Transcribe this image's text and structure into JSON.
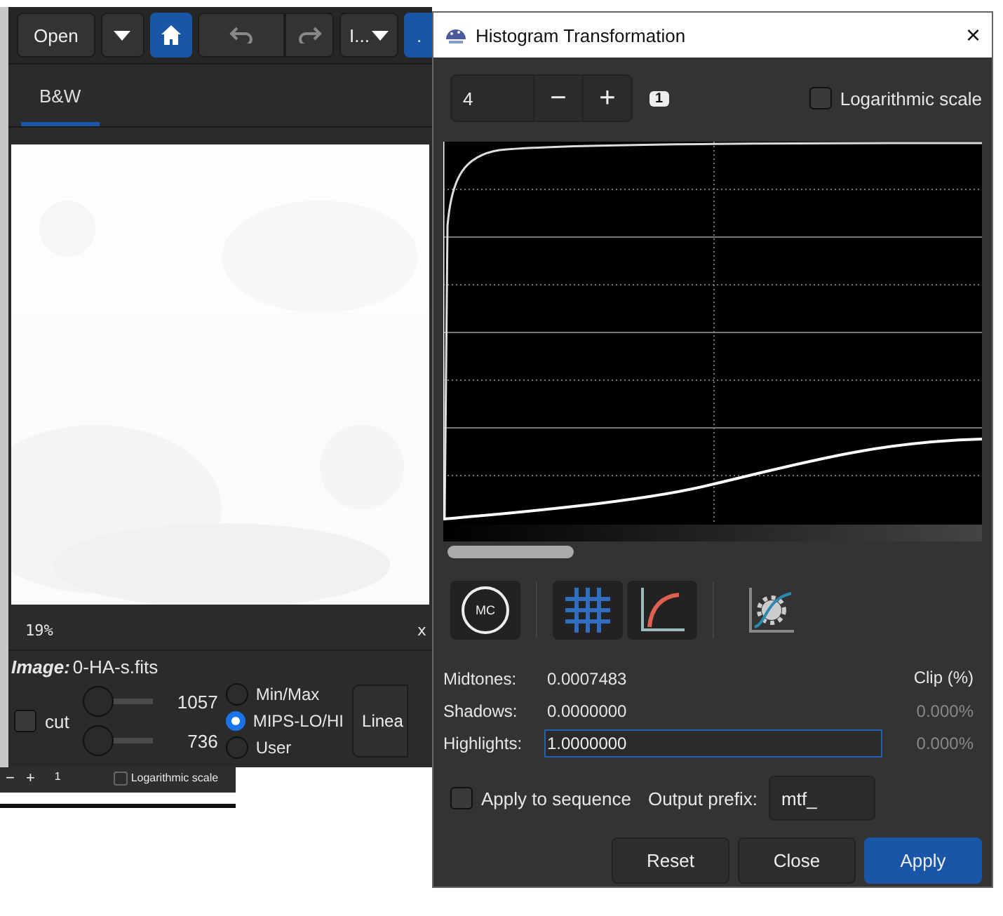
{
  "main_window": {
    "toolbar": {
      "open": "Open",
      "home_active": true,
      "undo_disabled": true,
      "redo_disabled": true,
      "menu": "I...",
      "extra": "."
    },
    "tabs": [
      {
        "label": "B&W",
        "selected": true
      }
    ],
    "status": {
      "zoom": "19%",
      "close": "x"
    },
    "image": {
      "label": "Image:",
      "name": "0-HA-s.fits"
    },
    "cut": {
      "label": "cut",
      "checked": false
    },
    "sliders": [
      {
        "level": 0,
        "value": "1057"
      },
      {
        "level": 0,
        "value": "736"
      }
    ],
    "radios": [
      {
        "label": "Min/Max",
        "selected": false
      },
      {
        "label": "MIPS-LO/HI",
        "selected": true
      },
      {
        "label": "User",
        "selected": false
      }
    ],
    "mode_button": "Linea"
  },
  "back_window": {
    "minus": "−",
    "plus": "+",
    "badge": "1",
    "log_label": "Logarithmic scale",
    "log_checked": false
  },
  "dialog": {
    "title": "Histogram Transformation",
    "close": "×",
    "zoom": {
      "value": "4",
      "minus": "−",
      "plus": "+",
      "badge": "1"
    },
    "log_scale": {
      "label": "Logarithmic scale",
      "checked": false
    },
    "mc_label": "MC",
    "clip_header": "Clip (%)",
    "params": [
      {
        "kind": "text",
        "label": "Midtones:",
        "value": "0.0007483"
      },
      {
        "kind": "text",
        "label": "Shadows:",
        "value": "0.0000000",
        "clip": "0.000%"
      },
      {
        "kind": "input",
        "label": "Highlights:",
        "value": "1.0000000",
        "clip": "0.000%"
      }
    ],
    "sequence": {
      "label": "Apply to sequence",
      "checked": false
    },
    "prefix": {
      "label": "Output prefix:",
      "value": "mtf_"
    },
    "buttons": [
      {
        "label": "Reset",
        "kind": "default"
      },
      {
        "label": "Close",
        "kind": "default"
      },
      {
        "label": "Apply",
        "kind": "primary"
      }
    ]
  }
}
